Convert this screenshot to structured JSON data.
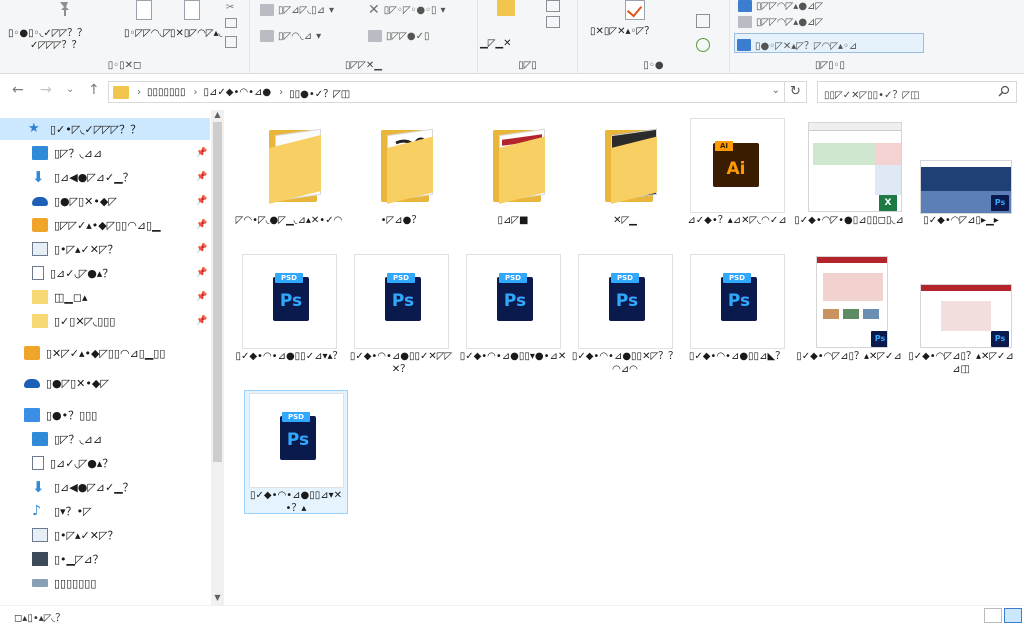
{
  "ribbon": {
    "groups": [
      {
        "label": "▯◦▯✕◻",
        "buttons": [
          "▯•●▯◦◟✓",
          "✓◸◸◸？？"
        ]
      },
      {
        "label": "▯◸◸✕▁",
        "buttons": [
          "▯◸⊿◟◠⊿",
          "▯◸◠◟⊿"
        ]
      },
      {
        "label": "▯✕■◦●◦▯",
        "buttons": [
          "▯◸◸◠◟⊿",
          "▯◸◸●✓▯"
        ]
      },
      {
        "label": "▯◸▯",
        "buttons": [
          "▁◸▁◸✕"
        ]
      },
      {
        "label": "▯◦●",
        "buttons": [
          "▯✕▯◸✕▴◦◸？"
        ]
      },
      {
        "label": "▯◸▯◦▯",
        "buttons": [
          "▯◸▯◸◸▴●⊿◸",
          "▯●◦◸✕▴◸？◸◠◸▴◦⊿"
        ]
      }
    ],
    "items": {
      "pin_label": "▯◦●▯◦◟✓◸◸？？",
      "copy_path": "▯◦◸◸◠◟◸",
      "cut_label": "▯✕▯◸◠◸▴◟",
      "move_to": "▯◸⊿◸◟▯⊿",
      "delete_label": "▯◸◦◸◦●◦▯",
      "select_all": "▯◸◸◠◸▴●⊿◸",
      "new_folder": "▁◸▁✕",
      "properties": "▯✕▯◸✕▴◦◸？",
      "select_none": "▯◸◸◠◸▴●⊿◸",
      "invert": "▯●◦◸✕▴◸？◸◠◸▴◦⊿"
    }
  },
  "address": {
    "back": "←",
    "forward": "→",
    "recent": "⌄",
    "up": "↑",
    "crumbs": [
      "▯▯▯▯▯▯▯",
      "▯⊿✓◆•◠•⊿●",
      "▯▯●•✓？◸◫"
    ],
    "search_placeholder": "▯▯◸✓✕◸▯▯•✓？◸◫"
  },
  "nav": {
    "items": [
      {
        "label": "▯✓•◸◟✓◸◸◸？？",
        "icon": "star-icon",
        "selected": true,
        "pinned": false
      },
      {
        "label": "▯◸？◟⊿⊿",
        "icon": "desktop-icon",
        "pinned": true
      },
      {
        "label": "▯⊿◀●◸⊿✓▁？",
        "icon": "download-icon",
        "pinned": true
      },
      {
        "label": "▯●◸▯✕•◆◸",
        "icon": "cloud-icon",
        "pinned": true
      },
      {
        "label": "▯◸◸✓▴•◆◸▯▯◠⊿▯▁",
        "icon": "creative-cloud-icon",
        "pinned": true
      },
      {
        "label": "▯•◸▴✓✕◸？",
        "icon": "pictures-icon",
        "pinned": true
      },
      {
        "label": "▯⊿✓◟◸●▴？",
        "icon": "documents-icon",
        "pinned": true
      },
      {
        "label": "◫▁◻▴",
        "icon": "folder-icon",
        "pinned": true
      },
      {
        "label": "▯✓▯✕◸◟▯▯▯",
        "icon": "folder-icon",
        "pinned": true
      },
      {
        "label": "▯✕◸✓▴•◆◸▯▯◠⊿▯▁▯▯",
        "icon": "creative-cloud-icon",
        "pinned": false
      },
      {
        "label": "▯●◸▯✕•◆◸",
        "icon": "cloud-icon",
        "pinned": false
      },
      {
        "label": "▯●•？▯▯▯",
        "icon": "computer-icon",
        "pinned": false
      },
      {
        "label": "▯◸？◟⊿⊿",
        "icon": "desktop-icon",
        "pinned": false
      },
      {
        "label": "▯⊿✓◟◸●▴？",
        "icon": "documents-icon",
        "pinned": false
      },
      {
        "label": "▯⊿◀●◸⊿✓▁？",
        "icon": "download-icon",
        "pinned": false
      },
      {
        "label": "▯▾？•◸",
        "icon": "music-icon",
        "pinned": false
      },
      {
        "label": "▯•◸▴✓✕◸？",
        "icon": "pictures-icon",
        "pinned": false
      },
      {
        "label": "▯•▁◸⊿？",
        "icon": "videos-icon",
        "pinned": false
      },
      {
        "label": "▯▯▯▯▯▯▯",
        "icon": "drive-icon",
        "pinned": false
      }
    ]
  },
  "files": [
    {
      "type": "folder",
      "variant": "plain",
      "name": "◸◠•◸◟●◸▁◟⊿▴✕•✓◠"
    },
    {
      "type": "folder",
      "variant": "sketch",
      "name": "•◸⊿●？"
    },
    {
      "type": "folder",
      "variant": "photos",
      "name": "▯⊿◸■"
    },
    {
      "type": "folder",
      "variant": "dark",
      "name": "✕◸▁"
    },
    {
      "type": "ai",
      "name": "⊿✓◆•？▴⊿✕◸◟◠✓⊿"
    },
    {
      "type": "excel-image",
      "name": "▯✓◆•◠◸•●▯⊿▯▯◻▯◟⊿"
    },
    {
      "type": "psd-image",
      "name": "▯✓◆•◠◸⊿▯▸▁▸"
    },
    {
      "type": "psd",
      "name": "▯✓◆•◠•⊿●▯▯✓⊿▾▴？"
    },
    {
      "type": "psd",
      "name": "▯✓◆•◠•⊿●▯▯✓✕◸◸✕？"
    },
    {
      "type": "psd",
      "name": "▯✓◆•◠•⊿●▯▯▾●•⊿✕"
    },
    {
      "type": "psd",
      "name": "▯✓◆•◠•⊿●▯▯✕◸？？◠⊿◠"
    },
    {
      "type": "psd",
      "name": "▯✓◆•◠•⊿●▯▯⊿◣？"
    },
    {
      "type": "psd-image",
      "name": "▯✓◆•◠◸⊿▯？▴✕◸✓⊿"
    },
    {
      "type": "psd-image",
      "name": "▯✓◆•◠◸⊿▯？▴✕◸✓⊿⊿◫"
    },
    {
      "type": "psd",
      "name": "▯✓◆•◠•⊿●▯▯⊿▾✕•？▴",
      "selected": true
    }
  ],
  "status": {
    "text": "◻▴▯•▴◸◟？"
  },
  "colors": {
    "accent": "#3b7ed0",
    "folder": "#f8cf62",
    "ps": "#31a8ff",
    "ai": "#ff9a00",
    "select": "#cce8ff"
  }
}
